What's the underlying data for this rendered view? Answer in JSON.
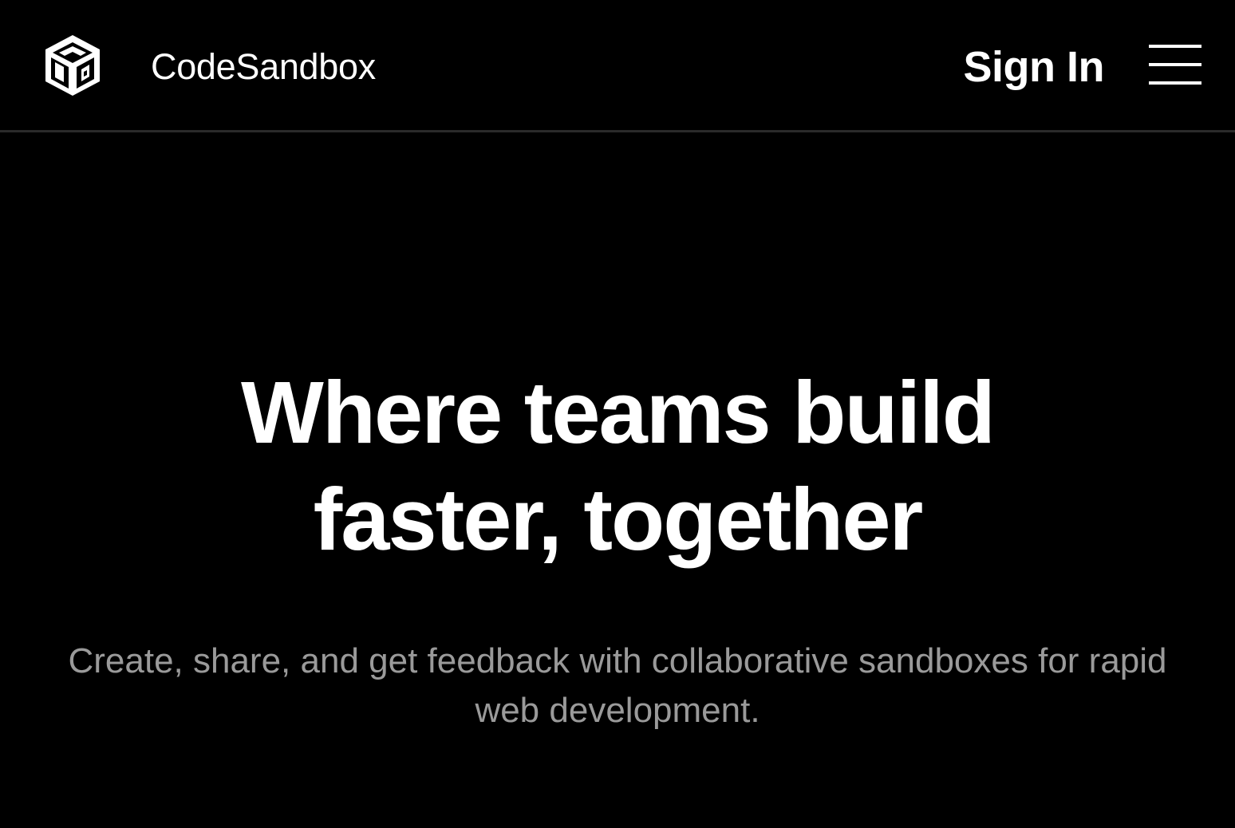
{
  "header": {
    "brand_name": "CodeSandbox",
    "logo_icon": "codesandbox-cube-icon",
    "sign_in_label": "Sign In",
    "menu_icon": "hamburger-menu-icon"
  },
  "hero": {
    "title_line1": "Where teams build",
    "title_line2": "faster, together",
    "subtitle": "Create, share, and get feedback with collaborative sandboxes for rapid web development."
  },
  "colors": {
    "background": "#000000",
    "text_primary": "#ffffff",
    "text_secondary": "#9a9a9a",
    "divider": "#2a2a2a"
  }
}
